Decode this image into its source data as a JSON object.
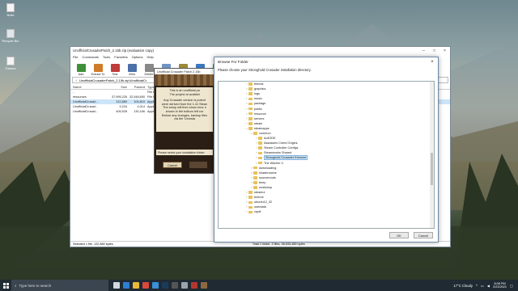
{
  "desktop": {
    "icons": [
      {
        "label": "Build",
        "icon": "file-icon"
      },
      {
        "label": "Recycle Bin",
        "icon": "recycle-bin-icon"
      },
      {
        "label": "Games",
        "icon": "file-icon"
      }
    ]
  },
  "winrar": {
    "title": "UnofficialCrusaderPatch_2.15b.zip (evaluation copy)",
    "menu": [
      "File",
      "Commands",
      "Tools",
      "Favorites",
      "Options",
      "Help"
    ],
    "toolbar": [
      {
        "label": "Add",
        "color": "#3f8f3a"
      },
      {
        "label": "Extract To",
        "color": "#d07b2a"
      },
      {
        "label": "Test",
        "color": "#c03b3b"
      },
      {
        "label": "View",
        "color": "#4b6fa8"
      },
      {
        "label": "Delete",
        "color": "#888888"
      },
      {
        "label": "Find",
        "color": "#6f94c4"
      },
      {
        "label": "Wizard",
        "color": "#9b8a3a"
      },
      {
        "label": "Info",
        "color": "#3b78c2"
      },
      {
        "label": "VirusScan",
        "color": "#3da33d"
      }
    ],
    "path": "UnofficialCrusaderPatch_2.15b.zip\\UnofficialCr",
    "columns": [
      "Name",
      "Size",
      "Packed",
      "Type"
    ],
    "files": [
      {
        "name": "..",
        "size": "",
        "packed": "",
        "type": "File fo"
      },
      {
        "name": "resources",
        "size": "37,995,226",
        "packed": "32,548,650",
        "type": "File fo"
      },
      {
        "name": "UnofficialCrusad...",
        "size": "122,880",
        "packed": "104,819",
        "type": "Applic"
      },
      {
        "name": "UnofficialCrusad...",
        "size": "9,216",
        "packed": "4,014",
        "type": "Applic"
      },
      {
        "name": "UnofficialCrusad...",
        "size": "406,528",
        "packed": "130,166",
        "type": "Applic"
      }
    ],
    "status_left": "Selected 1 file, 122,880 bytes",
    "status_right": "Total 1 folder, 3 files, 38,533,485 bytes"
  },
  "installer": {
    "title": "Unofficial Crusader Patch 2.15b",
    "body_lines": [
      "This is an unofficial pa",
      "The project at availabl",
      "Any Crusader version is potent",
      "were derived from the 1.41 Stean",
      "The setup will then show error n",
      "shown in the bottom left cor",
      "Before any changes, backup files",
      "via the 'Uninsta"
    ],
    "prompt": "Please select your installation folder:",
    "cancel_label": "Cancel"
  },
  "browse": {
    "title": "Browse For Folder",
    "instruction": "Please choose your Stronghold Crusader installation directory.",
    "tree": [
      {
        "label": "friends",
        "level": 0,
        "expanded": false,
        "selected": false
      },
      {
        "label": "graphics",
        "level": 0,
        "expanded": false,
        "selected": false
      },
      {
        "label": "logs",
        "level": 0,
        "expanded": false,
        "selected": false
      },
      {
        "label": "music",
        "level": 0,
        "expanded": false,
        "selected": false
      },
      {
        "label": "package",
        "level": 0,
        "expanded": false,
        "selected": false
      },
      {
        "label": "public",
        "level": 0,
        "expanded": false,
        "selected": false
      },
      {
        "label": "resource",
        "level": 0,
        "expanded": false,
        "selected": false
      },
      {
        "label": "servers",
        "level": 0,
        "expanded": false,
        "selected": false
      },
      {
        "label": "steam",
        "level": 0,
        "expanded": false,
        "selected": false
      },
      {
        "label": "steamapps",
        "level": 0,
        "expanded": true,
        "selected": false
      },
      {
        "label": "common",
        "level": 1,
        "expanded": true,
        "selected": false
      },
      {
        "label": "AoE2DE",
        "level": 2,
        "expanded": false,
        "selected": false
      },
      {
        "label": "Assassins Creed Origins",
        "level": 2,
        "expanded": false,
        "selected": false
      },
      {
        "label": "Steam Controller Configs",
        "level": 2,
        "expanded": false,
        "selected": false
      },
      {
        "label": "Steamworks Shared",
        "level": 2,
        "expanded": false,
        "selected": false
      },
      {
        "label": "Stronghold Crusader Extreme",
        "level": 2,
        "expanded": false,
        "selected": true
      },
      {
        "label": "The Witcher 3",
        "level": 2,
        "expanded": false,
        "selected": false
      },
      {
        "label": "downloading",
        "level": 1,
        "expanded": false,
        "selected": false
      },
      {
        "label": "shadercache",
        "level": 1,
        "expanded": false,
        "selected": false
      },
      {
        "label": "sourcemods",
        "level": 1,
        "expanded": false,
        "selected": false
      },
      {
        "label": "temp",
        "level": 1,
        "expanded": false,
        "selected": false
      },
      {
        "label": "workshop",
        "level": 1,
        "expanded": false,
        "selected": false
      },
      {
        "label": "steamui",
        "level": 0,
        "expanded": false,
        "selected": false
      },
      {
        "label": "tenfoot",
        "level": 0,
        "expanded": false,
        "selected": false
      },
      {
        "label": "ubuntu12_32",
        "level": 0,
        "expanded": false,
        "selected": false
      },
      {
        "label": "userdata",
        "level": 0,
        "expanded": false,
        "selected": false
      },
      {
        "label": "vrpdf",
        "level": 0,
        "expanded": false,
        "selected": false
      }
    ],
    "ok_label": "OK",
    "cancel_label": "Cancel"
  },
  "taskbar": {
    "search_placeholder": "Type here to search",
    "apps": [
      {
        "icon": "task-view-icon",
        "color": "#cfd8df"
      },
      {
        "icon": "edge-icon",
        "color": "#2d7fd3"
      },
      {
        "icon": "file-explorer-icon",
        "color": "#e8b93a"
      },
      {
        "icon": "chrome-icon",
        "color": "#d9493c"
      },
      {
        "icon": "store-icon",
        "color": "#3a8fd6"
      },
      {
        "icon": "steam-icon",
        "color": "#1b3b5a"
      },
      {
        "icon": "obs-icon",
        "color": "#555555"
      },
      {
        "icon": "settings-icon",
        "color": "#9aa4ad"
      },
      {
        "icon": "winrar-icon",
        "color": "#b2372f"
      },
      {
        "icon": "crusader-icon",
        "color": "#8c6a40"
      }
    ],
    "weather": "17°C Cloudy",
    "time": "8:08 PM",
    "date": "2/23/2021"
  }
}
